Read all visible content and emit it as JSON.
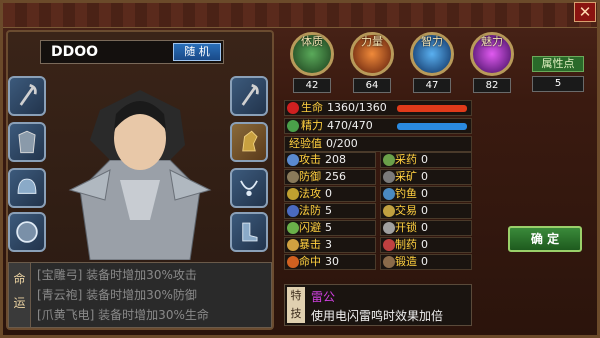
{
  "window": {
    "close_label": "✕"
  },
  "character": {
    "name": "DDOO",
    "random_button": "随 机"
  },
  "equipment_slots": [
    {
      "name": "weapon-slot-left",
      "icon": "axe-icon"
    },
    {
      "name": "armor-slot",
      "icon": "armor-icon"
    },
    {
      "name": "helmet-slot",
      "icon": "helmet-icon"
    },
    {
      "name": "shield-slot",
      "icon": "shield-icon"
    },
    {
      "name": "weapon-slot-right",
      "icon": "axe-icon"
    },
    {
      "name": "mount-slot",
      "icon": "horse-icon"
    },
    {
      "name": "necklace-slot",
      "icon": "necklace-icon"
    },
    {
      "name": "boots-slot",
      "icon": "boots-icon"
    }
  ],
  "fate": {
    "label_top": "命",
    "label_bottom": "运",
    "lines": [
      "[宝雕弓] 装备时增加30%攻击",
      "[青云袍] 装备时增加30%防御",
      "[爪黄飞电] 装备时增加30%生命"
    ]
  },
  "attributes": [
    {
      "label": "体质",
      "value": "42",
      "color": "#3a7a3a"
    },
    {
      "label": "力量",
      "value": "64",
      "color": "#c8501a"
    },
    {
      "label": "智力",
      "value": "47",
      "color": "#2a7ac0"
    },
    {
      "label": "魅力",
      "value": "82",
      "color": "#9a2ac0"
    }
  ],
  "points": {
    "label": "属性点",
    "value": "5"
  },
  "vitals": {
    "hp_label": "生命",
    "hp_value": "1360/1360",
    "hp_fraction": 1.0,
    "mp_label": "精力",
    "mp_value": "470/470",
    "mp_fraction": 1.0,
    "exp_label": "经验值",
    "exp_value": "0/200"
  },
  "stats": [
    {
      "label": "攻击",
      "value": "208",
      "icon_color": "#5a8ad0"
    },
    {
      "label": "采药",
      "value": "0",
      "icon_color": "#6aa04a"
    },
    {
      "label": "防御",
      "value": "256",
      "icon_color": "#8a7a5a"
    },
    {
      "label": "采矿",
      "value": "0",
      "icon_color": "#7a7a7a"
    },
    {
      "label": "法攻",
      "value": "0",
      "icon_color": "#c0a030"
    },
    {
      "label": "钓鱼",
      "value": "0",
      "icon_color": "#4a8ac0"
    },
    {
      "label": "法防",
      "value": "5",
      "icon_color": "#4a6ac0"
    },
    {
      "label": "交易",
      "value": "0",
      "icon_color": "#c0a040"
    },
    {
      "label": "闪避",
      "value": "5",
      "icon_color": "#6ab04a"
    },
    {
      "label": "开锁",
      "value": "0",
      "icon_color": "#a0a0a0"
    },
    {
      "label": "暴击",
      "value": "3",
      "icon_color": "#d0a040"
    },
    {
      "label": "制药",
      "value": "0",
      "icon_color": "#c04040"
    },
    {
      "label": "命中",
      "value": "30",
      "icon_color": "#d06020"
    },
    {
      "label": "锻造",
      "value": "0",
      "icon_color": "#8a6a4a"
    }
  ],
  "confirm_button": "确 定",
  "special": {
    "label": "特技",
    "name": "雷公",
    "description": "使用电闪雷鸣时效果加倍"
  }
}
